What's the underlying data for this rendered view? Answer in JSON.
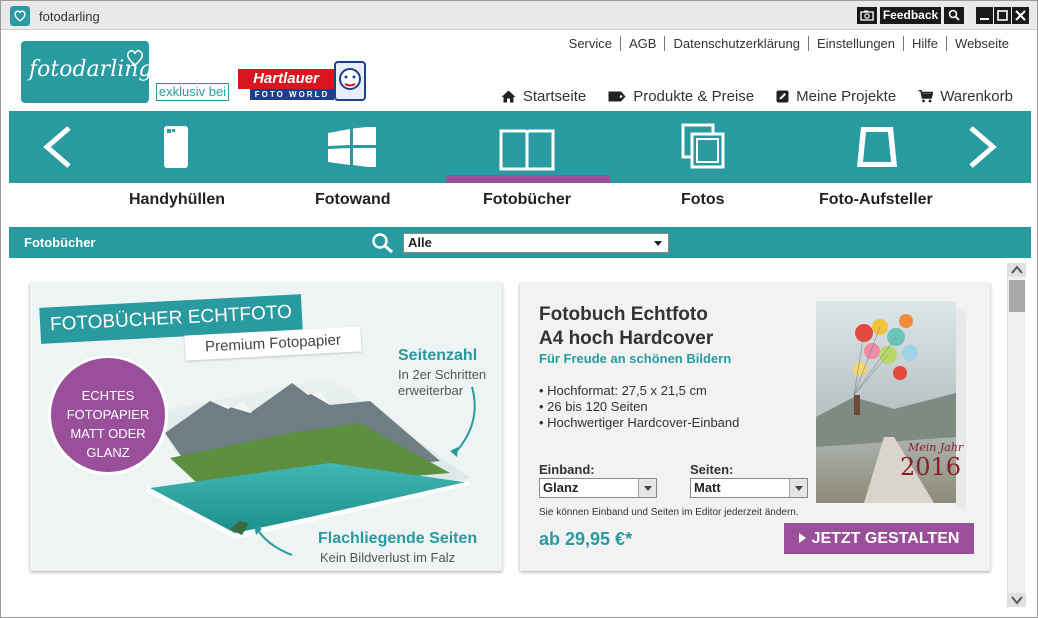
{
  "window": {
    "title": "fotodarling"
  },
  "titlebar": {
    "feedback_label": "Feedback"
  },
  "header": {
    "logo_text": "fotodarling",
    "exklusiv": "exklusiv bei",
    "partner_logo": "Hartlauer",
    "partner_sub": "FOTO WORLD",
    "top_links": [
      "Service",
      "AGB",
      "Datenschutzerklärung",
      "Einstellungen",
      "Hilfe",
      "Webseite"
    ],
    "main_nav": {
      "home": "Startseite",
      "products": "Produkte & Preise",
      "projects": "Meine Projekte",
      "cart": "Warenkorb"
    }
  },
  "categories": [
    {
      "label": "Handyhüllen",
      "icon": "phone-case-icon"
    },
    {
      "label": "Fotowand",
      "icon": "photo-wall-icon"
    },
    {
      "label": "Fotobücher",
      "icon": "photo-book-icon",
      "active": true
    },
    {
      "label": "Fotos",
      "icon": "photos-icon"
    },
    {
      "label": "Foto-Aufsteller",
      "icon": "photo-stand-icon"
    }
  ],
  "filter": {
    "title": "Fotobücher",
    "select_value": "Alle"
  },
  "banner": {
    "title": "FOTOBÜCHER ECHTFOTO",
    "subtitle": "Premium Fotopapier",
    "circle_lines": [
      "ECHTES",
      "FOTOPAPIER",
      "MATT ODER",
      "GLANZ"
    ],
    "seitenzahl": "Seitenzahl",
    "seitenzahl_desc": "In 2er Schritten erweiterbar",
    "flach": "Flachliegende Seiten",
    "flach_desc": "Kein Bildverlust im Falz"
  },
  "product": {
    "title_line1": "Fotobuch Echtfoto",
    "title_line2": "A4 hoch Hardcover",
    "subtitle": "Für Freude an schönen Bildern",
    "features": [
      "• Hochformat: 27,5 x 21,5 cm",
      "• 26 bis 120 Seiten",
      "• Hochwertiger Hardcover-Einband"
    ],
    "einband_label": "Einband:",
    "einband_value": "Glanz",
    "seiten_label": "Seiten:",
    "seiten_value": "Matt",
    "note": "Sie können Einband und Seiten im Editor jederzeit ändern.",
    "price": "ab 29,95 €*",
    "cta": "JETZT GESTALTEN",
    "book_text_1": "Mein Jahr",
    "book_text_2": "2016"
  },
  "colors": {
    "accent": "#2a9aa1",
    "purple": "#9a4f9a",
    "red": "#d7161f",
    "blue": "#1d3f8f"
  }
}
